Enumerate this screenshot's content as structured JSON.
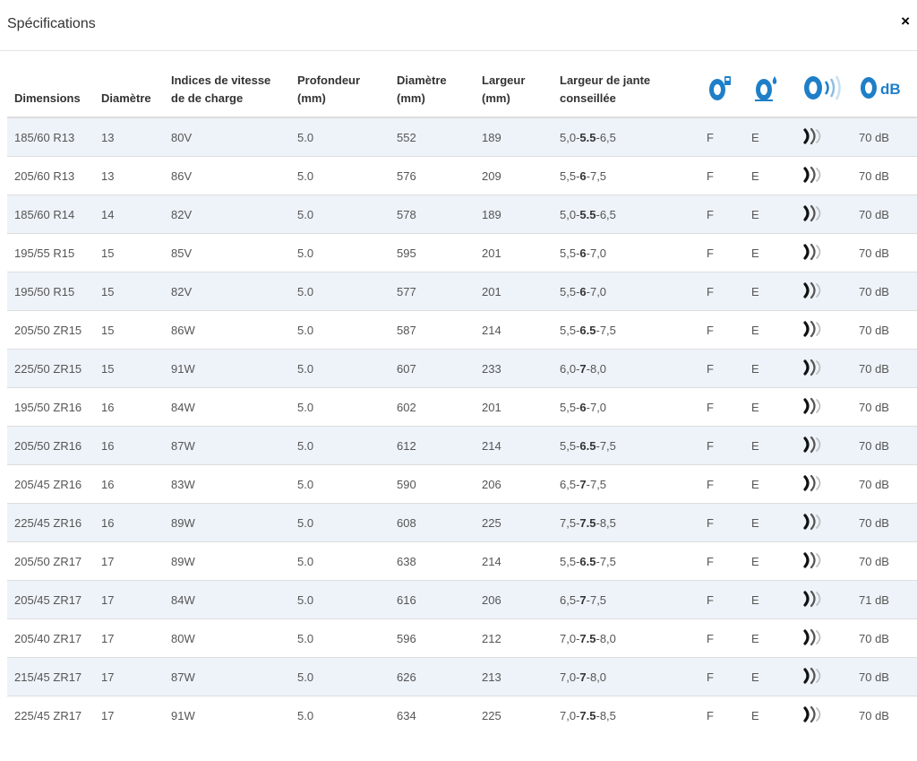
{
  "modal": {
    "title": "Spécifications",
    "close_label": "×"
  },
  "table": {
    "headers": {
      "dimensions": "Dimensions",
      "diametre": "Diamètre",
      "indices": "Indices de vitesse de de charge",
      "profondeur": "Profondeur (mm)",
      "diametre_mm": "Diamètre (mm)",
      "largeur": "Largeur (mm)",
      "largeur_jante": "Largeur de jante conseillée",
      "fuel_icon": "fuel-efficiency-icon",
      "wet_icon": "wet-grip-icon",
      "noise_icon": "noise-class-icon",
      "db_icon": "noise-db-icon",
      "db_text": "dB"
    },
    "rows": [
      {
        "dim": "185/60 R13",
        "diam": "13",
        "idx": "80V",
        "prof": "5.0",
        "dmm": "552",
        "larg": "189",
        "rim": [
          "5,0-",
          "5.5",
          "-6,5"
        ],
        "fuel": "F",
        "wet": "E",
        "db": "70 dB"
      },
      {
        "dim": "205/60 R13",
        "diam": "13",
        "idx": "86V",
        "prof": "5.0",
        "dmm": "576",
        "larg": "209",
        "rim": [
          "5,5-",
          "6",
          "-7,5"
        ],
        "fuel": "F",
        "wet": "E",
        "db": "70 dB"
      },
      {
        "dim": "185/60 R14",
        "diam": "14",
        "idx": "82V",
        "prof": "5.0",
        "dmm": "578",
        "larg": "189",
        "rim": [
          "5,0-",
          "5.5",
          "-6,5"
        ],
        "fuel": "F",
        "wet": "E",
        "db": "70 dB"
      },
      {
        "dim": "195/55 R15",
        "diam": "15",
        "idx": "85V",
        "prof": "5.0",
        "dmm": "595",
        "larg": "201",
        "rim": [
          "5,5-",
          "6",
          "-7,0"
        ],
        "fuel": "F",
        "wet": "E",
        "db": "70 dB"
      },
      {
        "dim": "195/50 R15",
        "diam": "15",
        "idx": "82V",
        "prof": "5.0",
        "dmm": "577",
        "larg": "201",
        "rim": [
          "5,5-",
          "6",
          "-7,0"
        ],
        "fuel": "F",
        "wet": "E",
        "db": "70 dB"
      },
      {
        "dim": "205/50 ZR15",
        "diam": "15",
        "idx": "86W",
        "prof": "5.0",
        "dmm": "587",
        "larg": "214",
        "rim": [
          "5,5-",
          "6.5",
          "-7,5"
        ],
        "fuel": "F",
        "wet": "E",
        "db": "70 dB"
      },
      {
        "dim": "225/50 ZR15",
        "diam": "15",
        "idx": "91W",
        "prof": "5.0",
        "dmm": "607",
        "larg": "233",
        "rim": [
          "6,0-",
          "7",
          "-8,0"
        ],
        "fuel": "F",
        "wet": "E",
        "db": "70 dB"
      },
      {
        "dim": "195/50 ZR16",
        "diam": "16",
        "idx": "84W",
        "prof": "5.0",
        "dmm": "602",
        "larg": "201",
        "rim": [
          "5,5-",
          "6",
          "-7,0"
        ],
        "fuel": "F",
        "wet": "E",
        "db": "70 dB"
      },
      {
        "dim": "205/50 ZR16",
        "diam": "16",
        "idx": "87W",
        "prof": "5.0",
        "dmm": "612",
        "larg": "214",
        "rim": [
          "5,5-",
          "6.5",
          "-7,5"
        ],
        "fuel": "F",
        "wet": "E",
        "db": "70 dB"
      },
      {
        "dim": "205/45 ZR16",
        "diam": "16",
        "idx": "83W",
        "prof": "5.0",
        "dmm": "590",
        "larg": "206",
        "rim": [
          "6,5-",
          "7",
          "-7,5"
        ],
        "fuel": "F",
        "wet": "E",
        "db": "70 dB"
      },
      {
        "dim": "225/45 ZR16",
        "diam": "16",
        "idx": "89W",
        "prof": "5.0",
        "dmm": "608",
        "larg": "225",
        "rim": [
          "7,5-",
          "7.5",
          "-8,5"
        ],
        "fuel": "F",
        "wet": "E",
        "db": "70 dB"
      },
      {
        "dim": "205/50 ZR17",
        "diam": "17",
        "idx": "89W",
        "prof": "5.0",
        "dmm": "638",
        "larg": "214",
        "rim": [
          "5,5-",
          "6.5",
          "-7,5"
        ],
        "fuel": "F",
        "wet": "E",
        "db": "70 dB"
      },
      {
        "dim": "205/45 ZR17",
        "diam": "17",
        "idx": "84W",
        "prof": "5.0",
        "dmm": "616",
        "larg": "206",
        "rim": [
          "6,5-",
          "7",
          "-7,5"
        ],
        "fuel": "F",
        "wet": "E",
        "db": "71 dB"
      },
      {
        "dim": "205/40 ZR17",
        "diam": "17",
        "idx": "80W",
        "prof": "5.0",
        "dmm": "596",
        "larg": "212",
        "rim": [
          "7,0-",
          "7.5",
          "-8,0"
        ],
        "fuel": "F",
        "wet": "E",
        "db": "70 dB"
      },
      {
        "dim": "215/45 ZR17",
        "diam": "17",
        "idx": "87W",
        "prof": "5.0",
        "dmm": "626",
        "larg": "213",
        "rim": [
          "7,0-",
          "7",
          "-8,0"
        ],
        "fuel": "F",
        "wet": "E",
        "db": "70 dB"
      },
      {
        "dim": "225/45 ZR17",
        "diam": "17",
        "idx": "91W",
        "prof": "5.0",
        "dmm": "634",
        "larg": "225",
        "rim": [
          "7,0-",
          "7.5",
          "-8,5"
        ],
        "fuel": "F",
        "wet": "E",
        "db": "70 dB"
      }
    ]
  },
  "colors": {
    "accent": "#1e7fc8",
    "row_stripe": "#eef3f9"
  }
}
